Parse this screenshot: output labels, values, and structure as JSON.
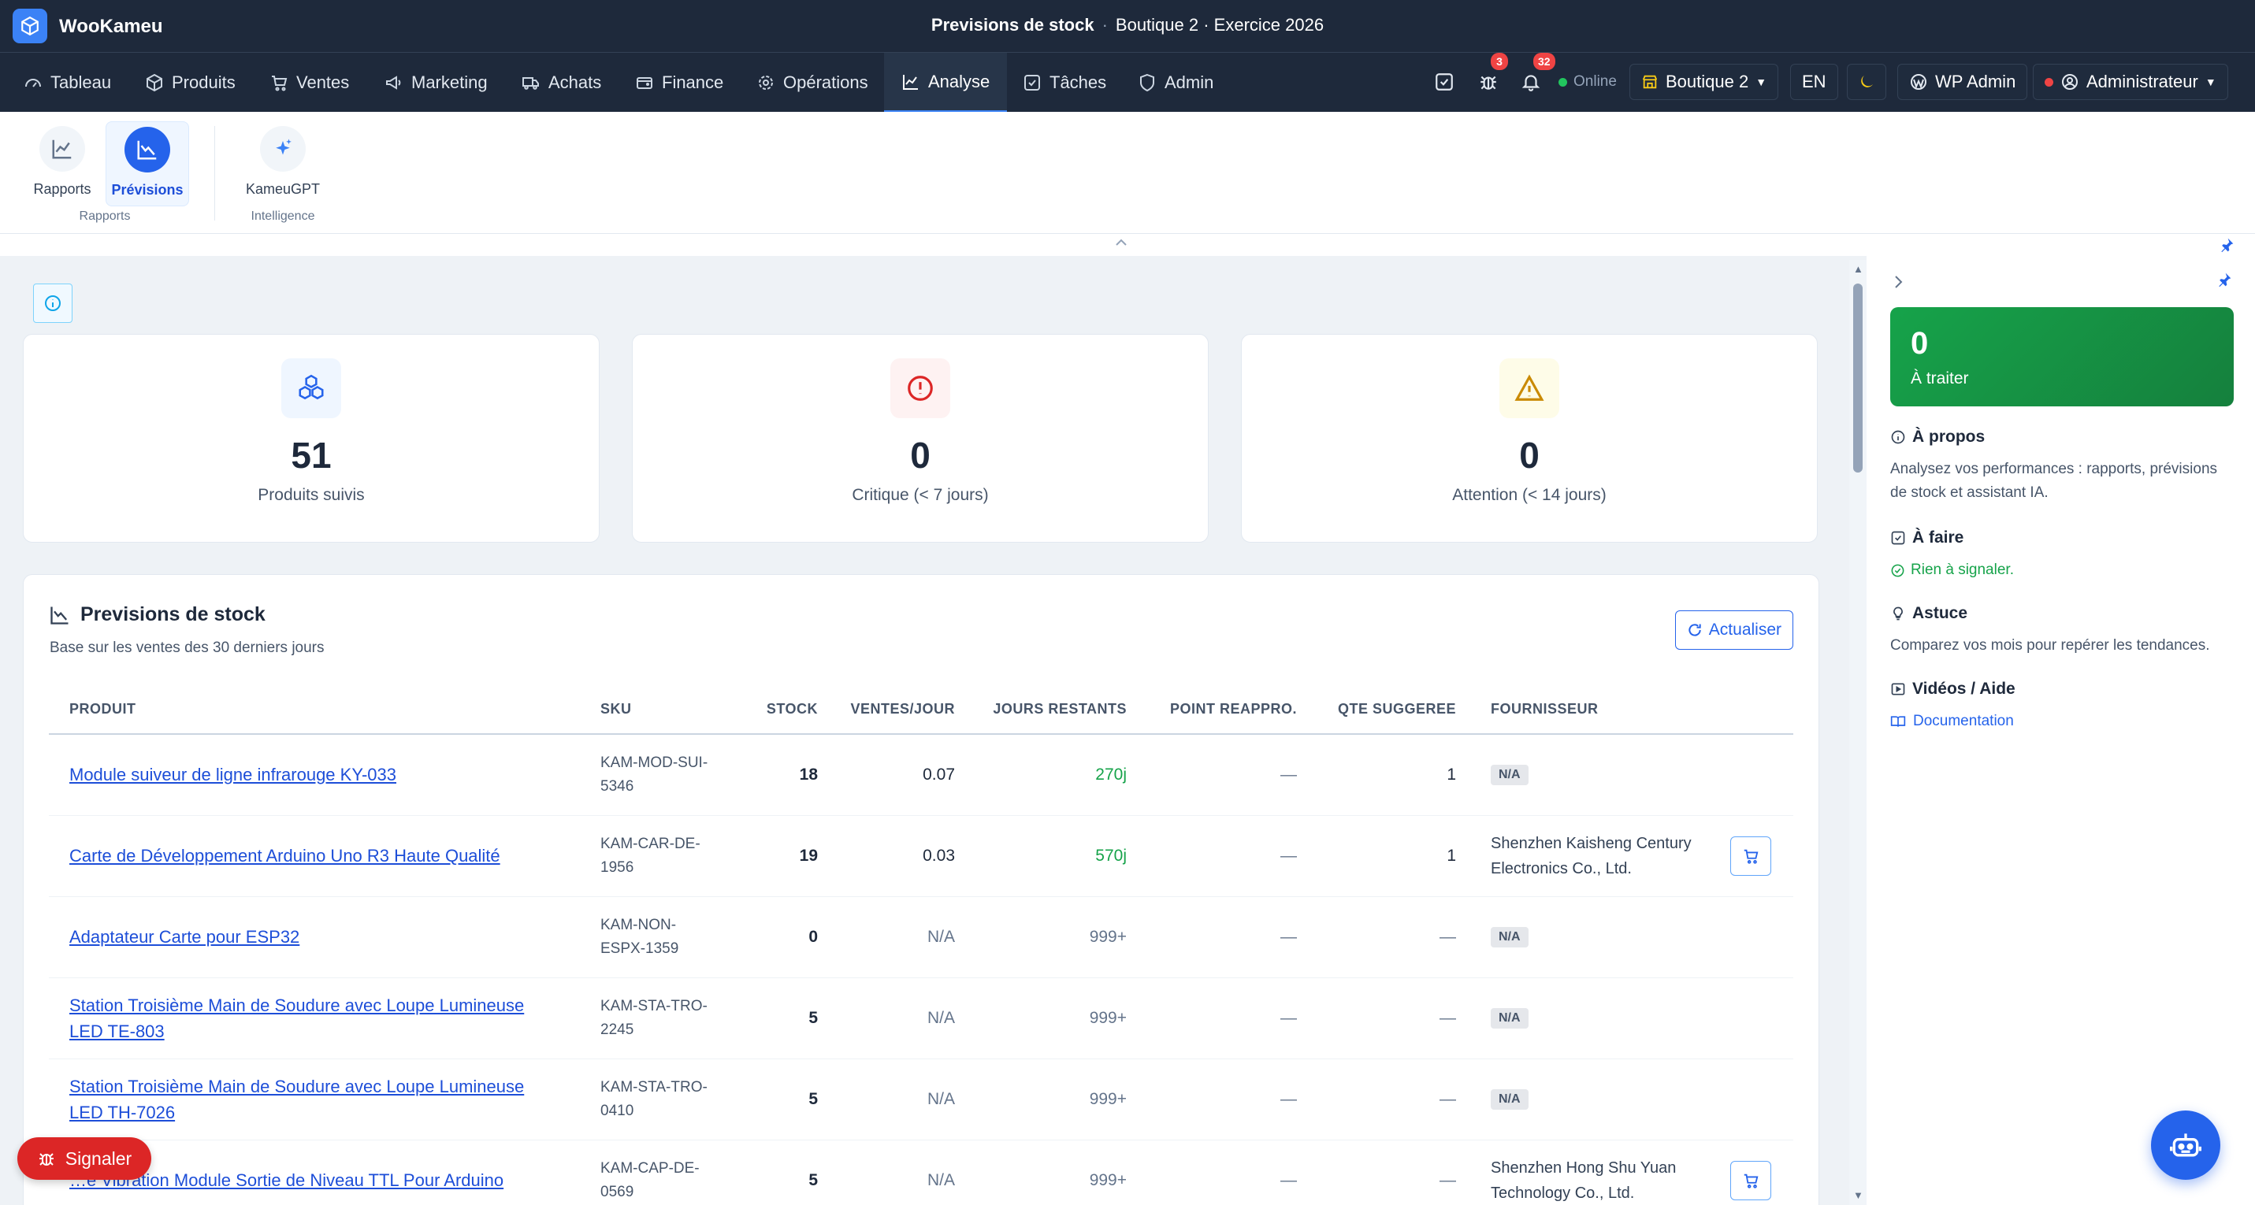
{
  "app": {
    "name": "WooKameu"
  },
  "header": {
    "page_title": "Previsions de stock",
    "context": "Boutique 2 · Exercice 2026"
  },
  "nav": {
    "items": [
      {
        "label": "Tableau"
      },
      {
        "label": "Produits"
      },
      {
        "label": "Ventes"
      },
      {
        "label": "Marketing"
      },
      {
        "label": "Achats"
      },
      {
        "label": "Finance"
      },
      {
        "label": "Opérations"
      },
      {
        "label": "Analyse"
      },
      {
        "label": "Tâches"
      },
      {
        "label": "Admin"
      }
    ],
    "active": "Analyse",
    "bug_badge": "3",
    "notif_badge": "32",
    "status": "Online",
    "store": "Boutique 2",
    "lang": "EN",
    "wp_admin": "WP Admin",
    "user": "Administrateur"
  },
  "ribbon": {
    "groups": [
      {
        "label": "Rapports",
        "buttons": [
          {
            "label": "Rapports"
          },
          {
            "label": "Prévisions"
          }
        ]
      },
      {
        "label": "Intelligence",
        "buttons": [
          {
            "label": "KameuGPT"
          }
        ]
      }
    ]
  },
  "stats": [
    {
      "value": "51",
      "label": "Produits suivis",
      "color": "#2563eb"
    },
    {
      "value": "0",
      "label": "Critique (< 7 jours)",
      "color": "#dc2626"
    },
    {
      "value": "0",
      "label": "Attention (< 14 jours)",
      "color": "#ca8a04"
    }
  ],
  "forecast": {
    "title": "Previsions de stock",
    "subtitle": "Base sur les ventes des 30 derniers jours",
    "refresh_label": "Actualiser",
    "columns": [
      "PRODUIT",
      "SKU",
      "STOCK",
      "VENTES/JOUR",
      "JOURS RESTANTS",
      "POINT REAPPRO.",
      "QTE SUGGEREE",
      "FOURNISSEUR"
    ],
    "rows": [
      {
        "product": "Module suiveur de ligne infrarouge KY-033",
        "sku": "KAM-MOD-SUI-5346",
        "stock": "18",
        "sales_per_day": "0.07",
        "days_left": "270j",
        "reorder": "—",
        "suggested": "1",
        "supplier": "",
        "supplier_badge": "N/A",
        "cart": false
      },
      {
        "product": "Carte de Développement Arduino Uno R3 Haute Qualité",
        "sku": "KAM-CAR-DE-1956",
        "stock": "19",
        "sales_per_day": "0.03",
        "days_left": "570j",
        "reorder": "—",
        "suggested": "1",
        "supplier": "Shenzhen Kaisheng Century Electronics Co., Ltd.",
        "supplier_badge": "",
        "cart": true
      },
      {
        "product": "Adaptateur Carte pour ESP32",
        "sku": "KAM-NON-ESPX-1359",
        "stock": "0",
        "sales_per_day": "N/A",
        "days_left": "999+",
        "reorder": "—",
        "suggested": "—",
        "supplier": "",
        "supplier_badge": "N/A",
        "cart": false
      },
      {
        "product": "Station Troisième Main de Soudure avec Loupe Lumineuse LED TE-803",
        "sku": "KAM-STA-TRO-2245",
        "stock": "5",
        "sales_per_day": "N/A",
        "days_left": "999+",
        "reorder": "—",
        "suggested": "—",
        "supplier": "",
        "supplier_badge": "N/A",
        "cart": false
      },
      {
        "product": "Station Troisième Main de Soudure avec Loupe Lumineuse LED TH-7026",
        "sku": "KAM-STA-TRO-0410",
        "stock": "5",
        "sales_per_day": "N/A",
        "days_left": "999+",
        "reorder": "—",
        "suggested": "—",
        "supplier": "",
        "supplier_badge": "N/A",
        "cart": false
      },
      {
        "product": "…e Vibration Module Sortie de Niveau TTL Pour Arduino",
        "sku": "KAM-CAP-DE-0569",
        "stock": "5",
        "sales_per_day": "N/A",
        "days_left": "999+",
        "reorder": "—",
        "suggested": "—",
        "supplier": "Shenzhen Hong Shu Yuan Technology Co., Ltd.",
        "supplier_badge": "",
        "cart": true
      }
    ]
  },
  "sidebar": {
    "todo_count": "0",
    "todo_label": "À traiter",
    "about_title": "À propos",
    "about_text": "Analysez vos performances : rapports, prévisions de stock et assistant IA.",
    "tasks_title": "À faire",
    "tasks_text": "Rien à signaler.",
    "tip_title": "Astuce",
    "tip_text": "Comparez vos mois pour repérer les tendances.",
    "help_title": "Vidéos / Aide",
    "help_link": "Documentation"
  },
  "report_button": "Signaler",
  "colors": {
    "navbar": "#1e293b",
    "accent": "#2563eb",
    "success": "#16a34a",
    "danger": "#dc2626",
    "warning": "#ca8a04"
  }
}
